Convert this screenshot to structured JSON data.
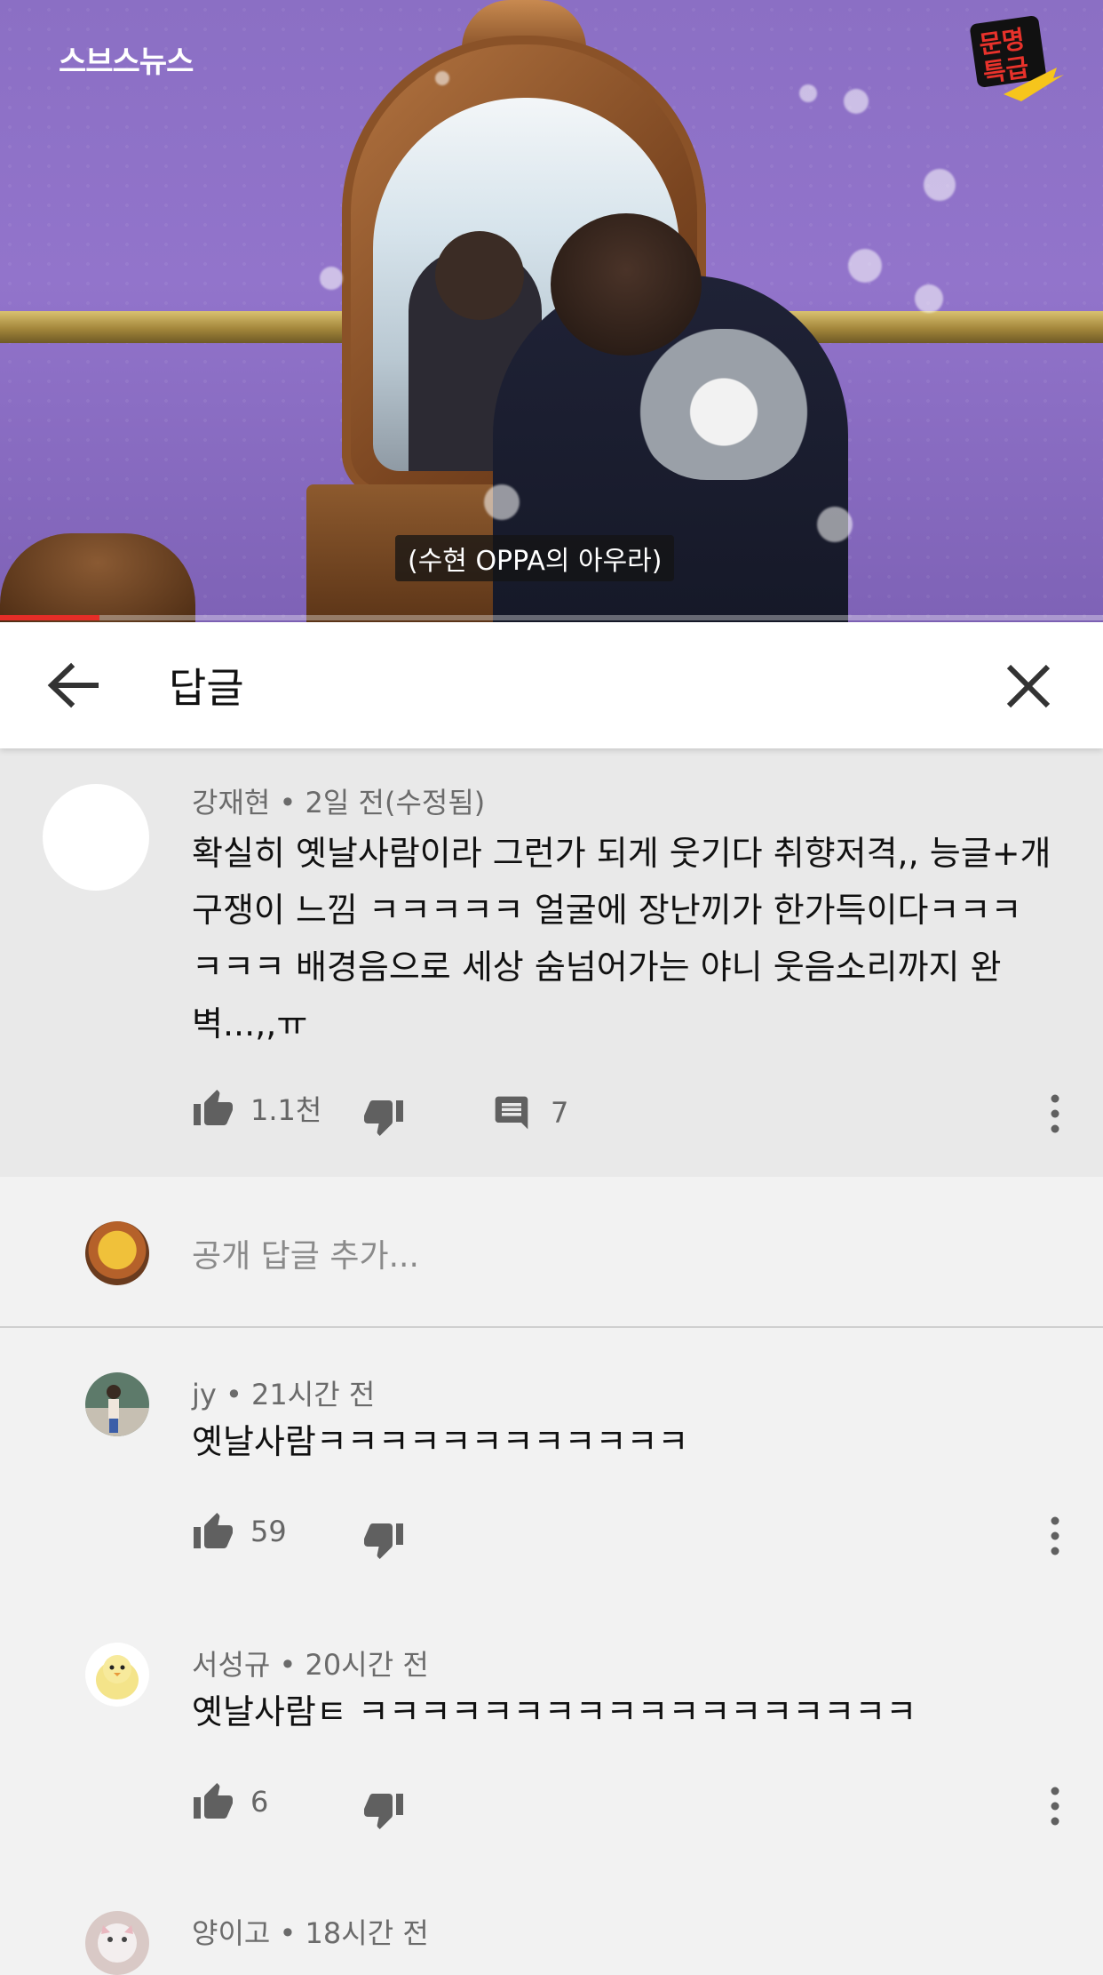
{
  "video": {
    "channel_logo": "스브스뉴스",
    "show_logo": "문명특급",
    "subtitle": "(수현 OPPA의 아우라)",
    "progress": 0.09
  },
  "header": {
    "title": "답글",
    "back_icon": "arrow-back-icon",
    "close_icon": "close-icon"
  },
  "parent_comment": {
    "author": "강재현",
    "time": "• 2일 전(수정됨)",
    "lines": [
      "확실히 옛날사람이라 그런가 되게 웃기다 취향저격,, 능글+개",
      "구쟁이 느낌 ㅋㅋㅋㅋㅋ 얼굴에 장난끼가 한가득이다ㅋㅋㅋ",
      "ㅋㅋㅋ 배경음으로 세상 숨넘어가는 야니 웃음소리까지 완",
      "벽...,,ㅠ"
    ],
    "likes": "1.1천",
    "reply_count": "7"
  },
  "add_reply": {
    "placeholder": "공개 답글 추가..."
  },
  "replies": [
    {
      "author": "jy",
      "time": "• 21시간 전",
      "text": "옛날사람ㅋㅋㅋㅋㅋㅋㅋㅋㅋㅋㅋㅋ",
      "likes": "59"
    },
    {
      "author": "서성규",
      "time": "• 20시간 전",
      "text": "옛날사람ㅌ ㅋㅋㅋㅋㅋㅋㅋㅋㅋㅋㅋㅋㅋㅋㅋㅋㅋㅋ",
      "likes": "6"
    },
    {
      "author": "양이고",
      "time": "• 18시간 전"
    }
  ],
  "colors": {
    "accent_red": "#e52d27",
    "icon_gray": "#606060"
  }
}
